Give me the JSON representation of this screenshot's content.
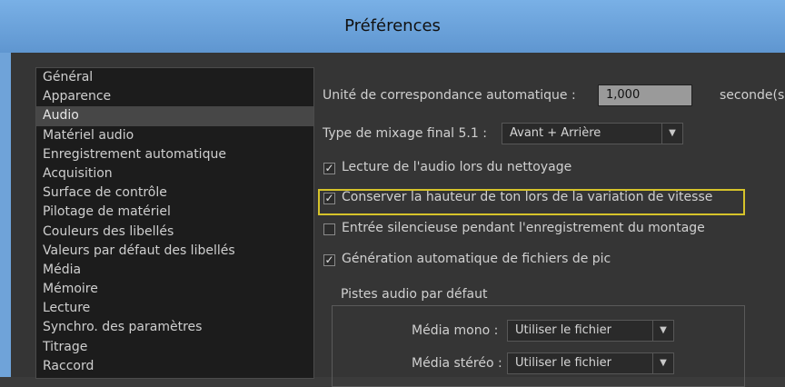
{
  "window": {
    "title": "Préférences"
  },
  "sidebar": {
    "items": [
      {
        "label": "Général"
      },
      {
        "label": "Apparence"
      },
      {
        "label": "Audio"
      },
      {
        "label": "Matériel audio"
      },
      {
        "label": "Enregistrement automatique"
      },
      {
        "label": "Acquisition"
      },
      {
        "label": "Surface de contrôle"
      },
      {
        "label": "Pilotage de matériel"
      },
      {
        "label": "Couleurs des libellés"
      },
      {
        "label": "Valeurs par défaut des libellés"
      },
      {
        "label": "Média"
      },
      {
        "label": "Mémoire"
      },
      {
        "label": "Lecture"
      },
      {
        "label": "Synchro. des paramètres"
      },
      {
        "label": "Titrage"
      },
      {
        "label": "Raccord"
      }
    ],
    "selected_label": "Audio"
  },
  "settings": {
    "auto_match_label": "Unité de correspondance automatique :",
    "auto_match_value": "1,000",
    "auto_match_unit": "seconde(s)",
    "mix_label": "Type de mixage final 5.1 :",
    "mix_value": "Avant + Arrière",
    "checks": [
      {
        "label": "Lecture de l'audio lors du nettoyage",
        "checked": true
      },
      {
        "label": "Conserver la hauteur de ton lors de la variation de vitesse",
        "checked": true
      },
      {
        "label": "Entrée silencieuse pendant l'enregistrement du montage",
        "checked": false
      },
      {
        "label": "Génération automatique de fichiers de pic",
        "checked": true
      }
    ],
    "default_tracks": {
      "title": "Pistes audio par défaut",
      "mono_label": "Média mono :",
      "mono_value": "Utiliser le fichier",
      "stereo_label": "Média stéréo :",
      "stereo_value": "Utiliser le fichier"
    }
  }
}
